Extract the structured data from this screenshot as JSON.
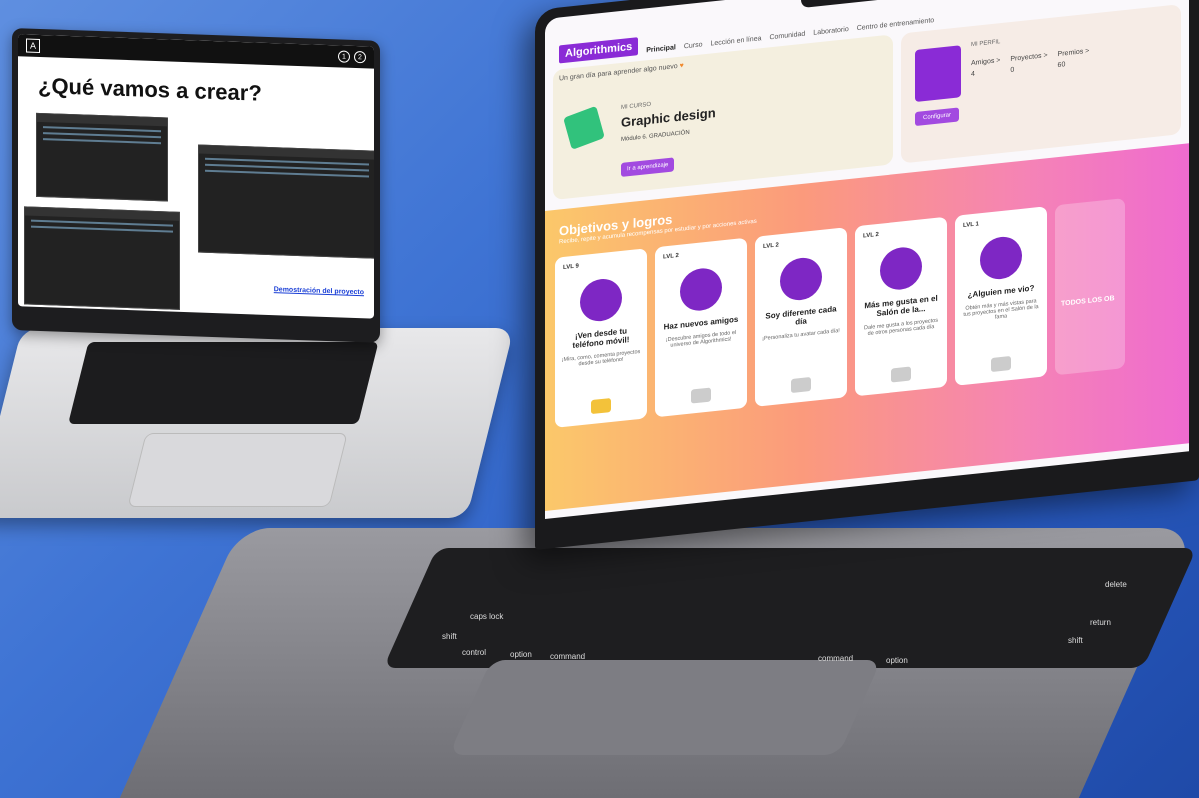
{
  "presentation": {
    "title": "¿Qué vamos a crear?",
    "link": "Demostración del proyecto",
    "pages": [
      "1",
      "2"
    ]
  },
  "app": {
    "brand": "Algorithmics",
    "nav": [
      "Principal",
      "Curso",
      "Lección en línea",
      "Comunidad",
      "Laboratorio",
      "Centro de entrenamiento"
    ],
    "greeting": "Un gran día para aprender algo nuevo",
    "course": {
      "label": "MI CURSO",
      "title": "Graphic design",
      "module": "Módulo 6. GRADUACIÓN",
      "button": "Ir a aprendizaje"
    },
    "profile": {
      "label": "MI PERFIL",
      "stats": [
        {
          "label": "Amigos >",
          "value": "4"
        },
        {
          "label": "Proyectos >",
          "value": "0"
        },
        {
          "label": "Premios >",
          "value": "60"
        }
      ],
      "button": "Configurar"
    },
    "goals": {
      "title": "Objetivos y logros",
      "subtitle": "Recibe, repite y acumula recompensas por estudiar y por acciones activas",
      "cards": [
        {
          "level": "LVL 9",
          "title": "¡Ven desde tu teléfono móvil!",
          "desc": "¡Mira, como, comenta proyectos desde su teléfono!",
          "chest": "gold"
        },
        {
          "level": "LVL 2",
          "title": "Haz nuevos amigos",
          "desc": "¡Descubre amigos de todo el universo de Algorithmics!",
          "chest": "grey"
        },
        {
          "level": "LVL 2",
          "title": "Soy diferente cada día",
          "desc": "¡Personaliza tu avatar cada día!",
          "chest": "grey"
        },
        {
          "level": "LVL 2",
          "title": "Más me gusta en el Salón de la...",
          "desc": "Dale me gusta a los proyectos de otros personas cada día",
          "chest": "grey"
        },
        {
          "level": "LVL 1",
          "title": "¿Alguien me vio?",
          "desc": "Obtén más y más vistas para tus proyectos en el Salón de la fama",
          "chest": "grey"
        }
      ],
      "all": "TODOS LOS OB"
    }
  },
  "keyboard": {
    "keys": [
      "caps lock",
      "shift",
      "control",
      "option",
      "command",
      "command",
      "option",
      "delete",
      "return",
      "shift"
    ]
  },
  "colors": {
    "accent": "#8a2bd6",
    "background": "#3f74d4"
  }
}
